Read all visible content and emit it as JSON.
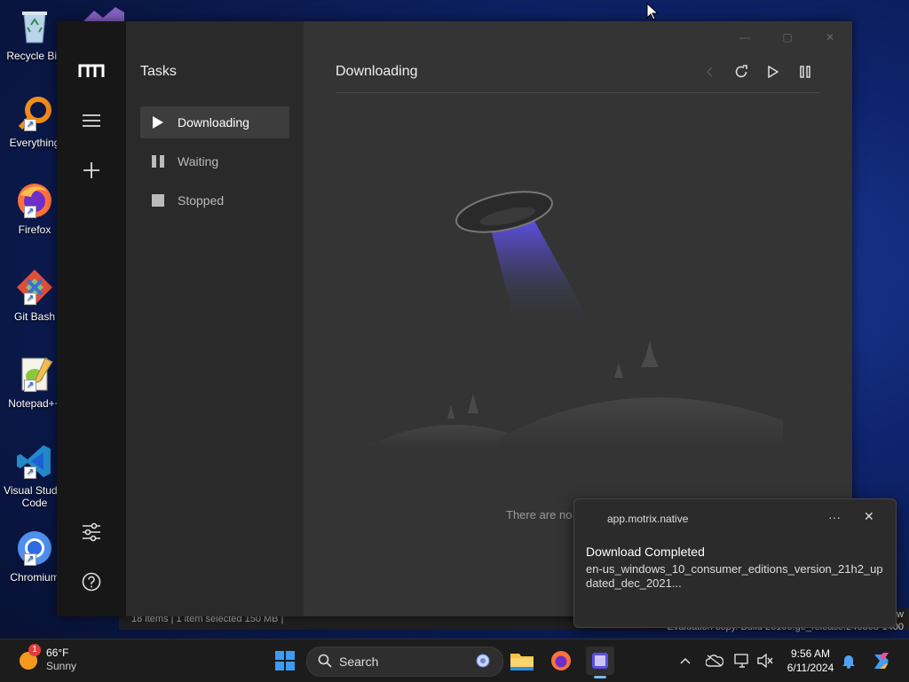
{
  "desktop": {
    "icons": [
      {
        "label": "Recycle Bin",
        "name": "recycle-bin-icon"
      },
      {
        "label": "Everything",
        "name": "everything-icon"
      },
      {
        "label": "Firefox",
        "name": "firefox-icon"
      },
      {
        "label": "Git Bash",
        "name": "git-bash-icon"
      },
      {
        "label": "Notepad++",
        "name": "notepad-plus-plus-icon"
      },
      {
        "label": "Visual Studio Code",
        "name": "vscode-icon"
      },
      {
        "label": "Chromium",
        "name": "chromium-icon"
      }
    ],
    "explorer_status": "18 items  |  1 item selected  150 MB  |",
    "watermark_line1": "ew",
    "watermark_line2": "Evaluation copy. Build 26100.ge_release.240308-1400"
  },
  "app": {
    "panel_title": "Tasks",
    "tasks": [
      {
        "label": "Downloading",
        "icon": "play-icon",
        "active": true
      },
      {
        "label": "Waiting",
        "icon": "pause-icon",
        "active": false
      },
      {
        "label": "Stopped",
        "icon": "stop-icon",
        "active": false
      }
    ],
    "main_title": "Downloading",
    "empty_text": "There are no",
    "toolbar": [
      "refresh-icon",
      "resume-all-icon",
      "pause-all-icon"
    ]
  },
  "toast": {
    "app_name": "app.motrix.native",
    "title": "Download Completed",
    "body": "en-us_windows_10_consumer_editions_version_21h2_updated_dec_2021..."
  },
  "taskbar": {
    "weather_temp": "66°F",
    "weather_desc": "Sunny",
    "weather_badge": "1",
    "search_placeholder": "Search",
    "time": "9:56 AM",
    "date": "6/11/2024"
  },
  "colors": {
    "accent_blue": "#1a62d6",
    "app_bg": "#343434",
    "rail_bg": "#171717",
    "ufo_beam": "#5b4fe0"
  }
}
